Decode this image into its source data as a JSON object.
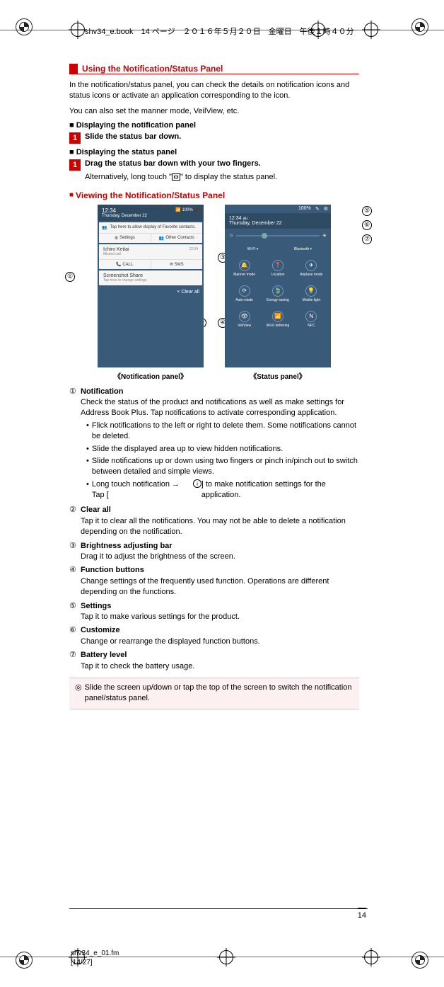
{
  "header": "shv34_e.book　14 ページ　２０１６年５月２０日　金曜日　午後１時４０分",
  "section_title": "Using the Notification/Status Panel",
  "intro_p1": "In the notification/status panel, you can check the details on notification icons and status icons or activate an application corresponding to the icon.",
  "intro_p2": "You can also set the manner mode, VeilView, etc.",
  "sub1": "Displaying the notification panel",
  "step1a": "Slide the status bar down.",
  "sub2": "Displaying the status panel",
  "step1b": "Drag the status bar down with your two fingers.",
  "step1b_sub_a": "Alternatively, long touch \"",
  "step1b_sub_b": "\" to display the status panel.",
  "red_heading": "Viewing the Notification/Status Panel",
  "panel_a": {
    "time": "12:34",
    "date": "Thursday, December 22",
    "battery": "100%",
    "favorite": "Tap here to allow display of Favorite contacts.",
    "btn_settings": "Settings",
    "btn_other": "Other Contacts",
    "call_name": "Ichiro Keitai",
    "call_sub": "Missed call",
    "call_time": "12:34",
    "call_action1": "CALL",
    "call_action2": "SMS",
    "ss_title": "Screenshot Share",
    "ss_sub": "Tap here to change settings.",
    "clear_all": "×  Clear all",
    "caption": "《Notification panel》"
  },
  "panel_b": {
    "time": "12:34",
    "carrier": "au",
    "date": "Thursday, December 22",
    "battery": "100%",
    "tiles_row1": [
      "Wi-Fi ▾",
      "Bluetooth ▾"
    ],
    "tiles_row2": [
      "Manner mode",
      "Location",
      "Airplane mode"
    ],
    "tiles_row3": [
      "Auto-rotate",
      "Energy saving",
      "Mobile light"
    ],
    "tiles_row4": [
      "VeilView",
      "Wi-Fi tethering",
      "NFC"
    ],
    "caption": "《Status panel》"
  },
  "callouts": [
    "①",
    "②",
    "③",
    "④",
    "⑤",
    "⑥",
    "⑦"
  ],
  "items": [
    {
      "num": "①",
      "title": "Notification",
      "desc": "Check the status of the product and notifications as well as make settings for Address Book Plus. Tap notifications to activate corresponding application.",
      "bullets": [
        "Flick notifications to the left or right to delete them. Some notifications cannot be deleted.",
        "Slide the displayed area up to view hidden notifications.",
        "Slide notifications up or down using two fingers or pinch in/pinch out to switch between detailed and simple views.",
        "Long touch notification → Tap [ ⓘ ] to make notification settings for the application."
      ]
    },
    {
      "num": "②",
      "title": "Clear all",
      "desc": "Tap it to clear all the notifications. You may not be able to delete a notification depending on the notification."
    },
    {
      "num": "③",
      "title": "Brightness adjusting bar",
      "desc": "Drag it to adjust the brightness of the screen."
    },
    {
      "num": "④",
      "title": "Function buttons",
      "desc": "Change settings of the frequently used function. Operations are different depending on the functions."
    },
    {
      "num": "⑤",
      "title": "Settings",
      "desc": "Tap it to make various settings for the product."
    },
    {
      "num": "⑥",
      "title": "Customize",
      "desc": "Change or rearrange the displayed function buttons."
    },
    {
      "num": "⑦",
      "title": "Battery level",
      "desc": "Tap it to check the battery usage."
    }
  ],
  "note": "Slide the screen up/down or tap the top of the screen to switch the notification panel/status panel.",
  "note_icon": "◎",
  "page_num": "14",
  "footer_file": "shv34_e_01.fm",
  "footer_page": "[14/27]"
}
